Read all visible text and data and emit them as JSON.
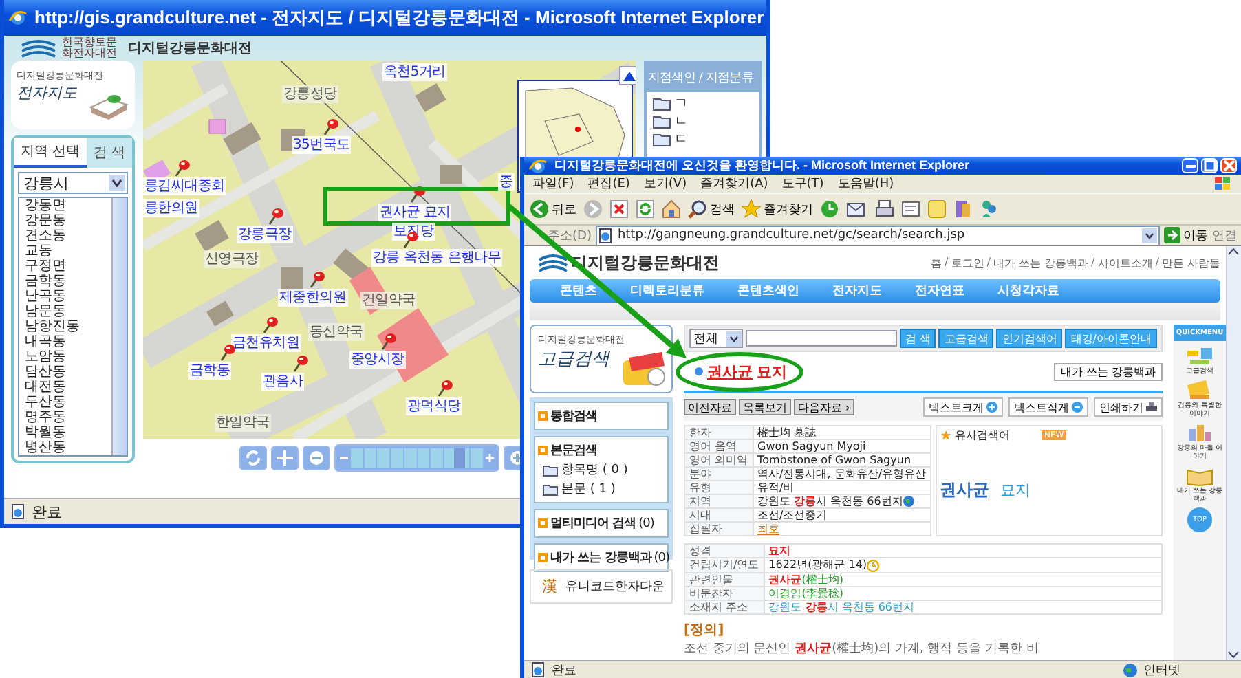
{
  "map_window": {
    "title": "http://gis.grandculture.net - 전자지도 / 디지털강릉문화대전 - Microsoft Internet Explorer",
    "header": {
      "org": "한국향토문화전자대전",
      "site": "디지털강릉문화대전"
    },
    "side": {
      "site": "디지털강릉문화대전",
      "title": "전자지도",
      "tabs": [
        {
          "label": "지역 선택",
          "selected": true
        },
        {
          "label": "검 색",
          "selected": false
        }
      ],
      "city": "강릉시",
      "districts": [
        "강동면",
        "강문동",
        "견소동",
        "교동",
        "구정면",
        "금학동",
        "난곡동",
        "남문동",
        "남항진동",
        "내곡동",
        "노암동",
        "담산동",
        "대전동",
        "두산동",
        "명주동",
        "박월동",
        "병산동"
      ]
    },
    "map": {
      "places": [
        {
          "label": "옥천5거리",
          "kind": "site",
          "pinned": false,
          "highlighted": false
        },
        {
          "label": "강릉성당",
          "kind": "base",
          "pinned": false,
          "highlighted": false
        },
        {
          "label": "35번국도",
          "kind": "site",
          "pinned": true,
          "highlighted": false
        },
        {
          "label": "릉김씨대종회",
          "kind": "site",
          "pinned": true,
          "highlighted": false
        },
        {
          "label": "릉한의원",
          "kind": "site",
          "pinned": false,
          "highlighted": false
        },
        {
          "label": "강릉극장",
          "kind": "site",
          "pinned": true,
          "highlighted": false
        },
        {
          "label": "신영극장",
          "kind": "base",
          "pinned": false,
          "highlighted": false
        },
        {
          "label": "권사균 묘지",
          "kind": "site",
          "pinned": true,
          "highlighted": true
        },
        {
          "label": "보진당",
          "kind": "site",
          "pinned": false,
          "highlighted": false
        },
        {
          "label": "강릉 옥천동 은행나무",
          "kind": "site",
          "pinned": true,
          "highlighted": false
        },
        {
          "label": "제중한의원",
          "kind": "site",
          "pinned": true,
          "highlighted": false
        },
        {
          "label": "건일약국",
          "kind": "base",
          "pinned": false,
          "highlighted": false
        },
        {
          "label": "동신약국",
          "kind": "base",
          "pinned": false,
          "highlighted": false
        },
        {
          "label": "금천유치원",
          "kind": "site",
          "pinned": true,
          "highlighted": false
        },
        {
          "label": "중앙시장",
          "kind": "site",
          "pinned": true,
          "highlighted": false
        },
        {
          "label": "금학동",
          "kind": "site",
          "pinned": true,
          "highlighted": false
        },
        {
          "label": "관음사",
          "kind": "site",
          "pinned": true,
          "highlighted": false
        },
        {
          "label": "광덕식당",
          "kind": "site",
          "pinned": true,
          "highlighted": false
        },
        {
          "label": "한일약국",
          "kind": "base",
          "pinned": false,
          "highlighted": false
        },
        {
          "label": "중",
          "kind": "site",
          "pinned": false,
          "highlighted": false
        }
      ],
      "zoom": {
        "level": 0.82
      }
    },
    "index_panel": {
      "title": "지점색인 / 지점분류",
      "folders": [
        "ㄱ",
        "ㄴ",
        "ㄷ"
      ]
    },
    "status": "완료"
  },
  "article_window": {
    "title": "디지털강릉문화대전에 오신것을 환영합니다. - Microsoft Internet Explorer",
    "menu": [
      "파일(F)",
      "편집(E)",
      "보기(V)",
      "즐겨찾기(A)",
      "도구(T)",
      "도움말(H)"
    ],
    "toolbar": {
      "back": "뒤로",
      "search": "검색",
      "favorites": "즐겨찾기"
    },
    "address": {
      "label": "주소(D)",
      "url": "http://gangneung.grandculture.net/gc/search/search.jsp",
      "go": "이동",
      "links": "연결"
    },
    "site": {
      "logo": "디지털강릉문화대전",
      "separator": "/",
      "top_links": [
        "홈",
        "로그인",
        "내가 쓰는 강릉백과",
        "사이트소개",
        "만든 사람들"
      ],
      "nav": [
        "콘텐츠",
        "디렉토리분류",
        "콘텐츠색인",
        "전자지도",
        "전자연표",
        "시청각자료"
      ]
    },
    "sidebar": {
      "brand": "디지털강릉문화대전",
      "title": "고급검색",
      "sections": [
        {
          "label": "통합검색"
        },
        {
          "label": "본문검색",
          "children": [
            "항목명 ( 0 )",
            "본문 ( 1 )"
          ]
        },
        {
          "label": "멀티미디어 검색",
          "count": "(0)"
        },
        {
          "label": "내가 쓰는 강릉백과",
          "count": "(0)"
        }
      ],
      "hanja": {
        "glyph": "漢",
        "label": "유니코드한자다운"
      }
    },
    "search": {
      "scope": "전체",
      "buttons": [
        "검 색",
        "고급검색",
        "인기검색어",
        "태깅/아이콘안내"
      ]
    },
    "article": {
      "title_link": "권사균",
      "title_rest": "묘지",
      "circled": true,
      "wiki_button": "내가 쓰는 강릉백과",
      "nav_buttons": [
        "이전자료",
        "목록보기",
        "다음자료 ›"
      ],
      "text_buttons": [
        {
          "label": "텍스트크게",
          "kind": "plus"
        },
        {
          "label": "텍스트작게",
          "kind": "minus"
        },
        {
          "label": "인쇄하기",
          "kind": "print"
        }
      ],
      "facts": [
        {
          "label": "한자",
          "value": "權士均 墓誌",
          "kind": "text"
        },
        {
          "label": "영어 음역",
          "value": "Gwon Sagyun Myoji",
          "kind": "text"
        },
        {
          "label": "영어 의미역",
          "value": "Tombstone of Gwon Sagyun",
          "kind": "text"
        },
        {
          "label": "분야",
          "value": "역사/전통시대, 문화유산/유형유산",
          "kind": "text"
        },
        {
          "label": "유형",
          "value": "유적/비",
          "kind": "text"
        },
        {
          "label": "지역",
          "value": "강원도 **강릉**시 옥천동 66번지",
          "kind": "place"
        },
        {
          "label": "시대",
          "value": "조선/조선중기",
          "kind": "text"
        },
        {
          "label": "집필자",
          "value": "최호",
          "kind": "link"
        }
      ],
      "related": {
        "label": "유사검색어",
        "badge": "NEW",
        "terms": [
          "권사균",
          "묘지"
        ]
      },
      "details": [
        {
          "label": "성격",
          "value": "묘지",
          "kind": "strong"
        },
        {
          "label": "건립시기/연도",
          "value": "1622년(광해군 14)",
          "kind": "date"
        },
        {
          "label": "관련인물",
          "value": "**권사균**(權士均)",
          "kind": "person"
        },
        {
          "label": "비문찬자",
          "value": "이경임(李景稔)",
          "kind": "person"
        },
        {
          "label": "소재지 주소",
          "value": "강원도 **강릉**시 옥천동 66번지",
          "kind": "address"
        }
      ],
      "definition": {
        "heading": "[정의]",
        "text": "조선 중기의 문신인 **권사균**(權士均)의 가계, 행적 등을 기록한 비"
      }
    },
    "quickmenu": {
      "title": "QUICKMENU",
      "items": [
        "고급검색",
        "강릉의 특별한 이야기",
        "강릉의 마을 이야기",
        "내가 쓰는 강릉백과"
      ],
      "top": "TOP"
    },
    "status": "완료",
    "zone": "인터넷"
  }
}
